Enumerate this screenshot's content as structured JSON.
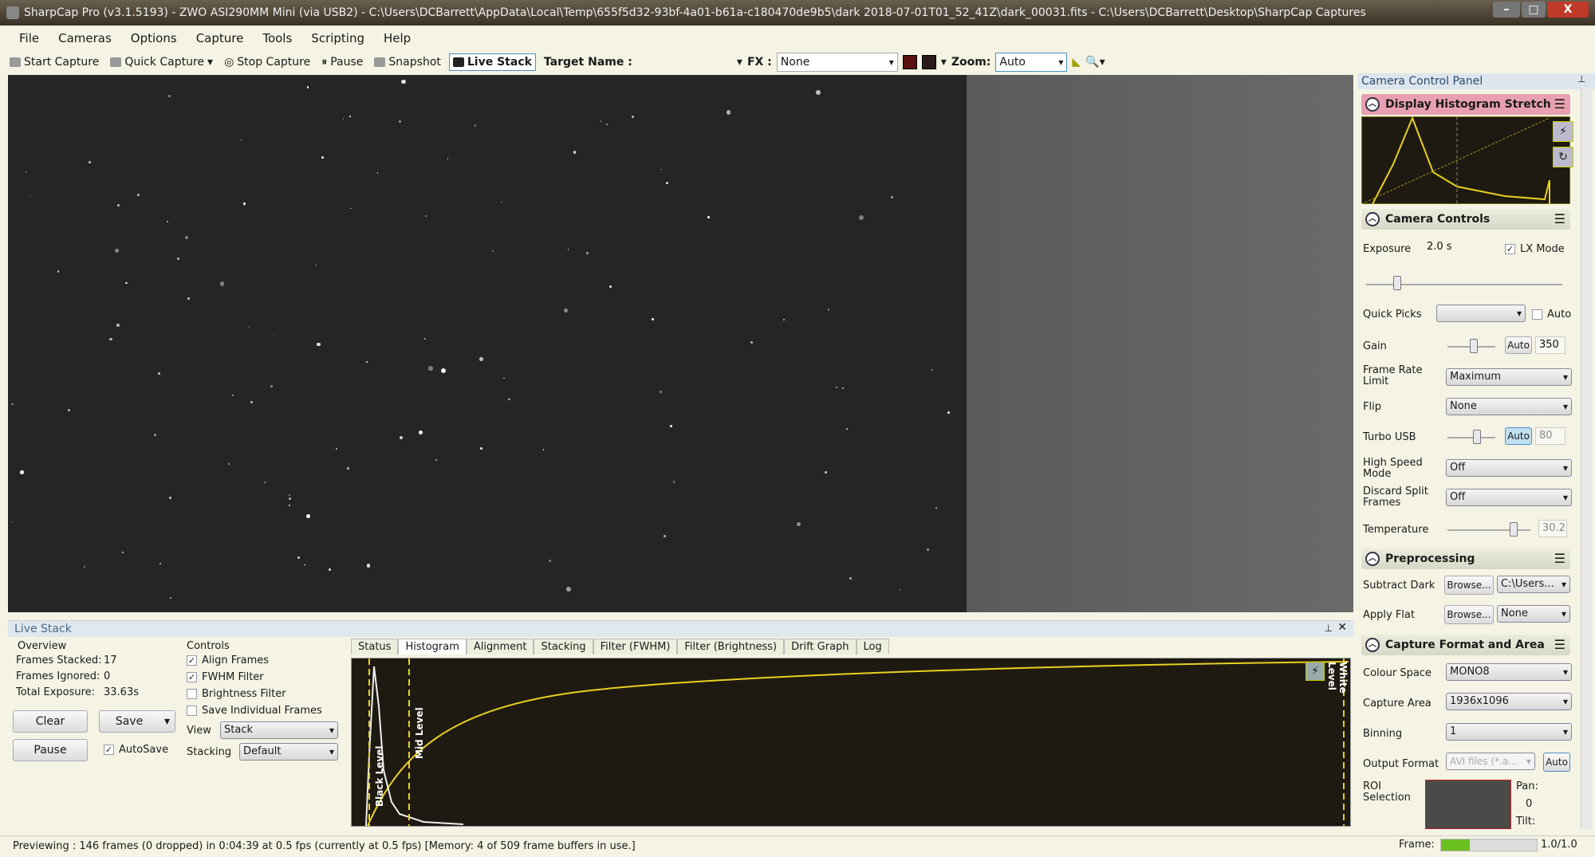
{
  "window": {
    "title": "SharpCap Pro (v3.1.5193) - ZWO ASI290MM Mini (via USB2) - C:\\Users\\DCBarrett\\AppData\\Local\\Temp\\655f5d32-93bf-4a01-b61a-c180470de9b5\\dark 2018-07-01T01_52_41Z\\dark_00031.fits - C:\\Users\\DCBarrett\\Desktop\\SharpCap Captures",
    "min": "–",
    "max": "□",
    "close": "X"
  },
  "menu": [
    "File",
    "Cameras",
    "Options",
    "Capture",
    "Tools",
    "Scripting",
    "Help"
  ],
  "toolbar": {
    "start_capture": "Start Capture",
    "quick_capture": "Quick Capture",
    "stop_capture": "Stop Capture",
    "pause": "Pause",
    "snapshot": "Snapshot",
    "live_stack": "Live Stack",
    "target_name": "Target Name :",
    "fx_label": "FX :",
    "fx_value": "None",
    "zoom_label": "Zoom:",
    "zoom_value": "Auto"
  },
  "live_stack": {
    "title": "Live Stack",
    "overview": "Overview",
    "frames_stacked_label": "Frames Stacked:",
    "frames_stacked": "17",
    "frames_ignored_label": "Frames Ignored:",
    "frames_ignored": "0",
    "total_exposure_label": "Total Exposure:",
    "total_exposure": "33.63s",
    "clear": "Clear",
    "save": "Save",
    "pause": "Pause",
    "autosave": "AutoSave",
    "autosave_checked": true,
    "controls": "Controls",
    "checkboxes": [
      {
        "label": "Align Frames",
        "checked": true
      },
      {
        "label": "FWHM Filter",
        "checked": true
      },
      {
        "label": "Brightness Filter",
        "checked": false
      },
      {
        "label": "Save Individual Frames",
        "checked": false
      }
    ],
    "view_label": "View",
    "view_value": "Stack",
    "stacking_label": "Stacking",
    "stacking_value": "Default",
    "tabs": [
      "Status",
      "Histogram",
      "Alignment",
      "Stacking",
      "Filter (FWHM)",
      "Filter (Brightness)",
      "Drift Graph",
      "Log"
    ],
    "active_tab": "Histogram",
    "hist_labels": {
      "black": "Black Level",
      "mid": "Mid Level",
      "white": "White Level"
    }
  },
  "panel": {
    "title": "Camera Control Panel",
    "display_stretch": "Display Histogram Stretch",
    "camera_controls": "Camera Controls",
    "exposure_label": "Exposure",
    "exposure_value": "2.0 s",
    "lx_mode": "LX Mode",
    "lx_checked": true,
    "quick_picks": "Quick Picks",
    "quick_auto": "Auto",
    "gain_label": "Gain",
    "gain_auto": "Auto",
    "gain_value": "350",
    "gain_level": 0.55,
    "frame_rate_label": "Frame Rate Limit",
    "frame_rate_value": "Maximum",
    "flip_label": "Flip",
    "flip_value": "None",
    "turbo_label": "Turbo USB",
    "turbo_auto": "Auto",
    "turbo_value": "80",
    "hsm_label": "High Speed Mode",
    "hsm_value": "Off",
    "discard_label": "Discard Split Frames",
    "discard_value": "Off",
    "temp_label": "Temperature",
    "temp_value": "30.2",
    "preprocessing": "Preprocessing",
    "subtract_dark_label": "Subtract Dark",
    "browse": "Browse...",
    "subtract_dark_value": "C:\\Users...",
    "apply_flat_label": "Apply Flat",
    "apply_flat_value": "None",
    "capture_format": "Capture Format and Area",
    "colour_space_label": "Colour Space",
    "colour_space_value": "MONO8",
    "capture_area_label": "Capture Area",
    "capture_area_value": "1936x1096",
    "binning_label": "Binning",
    "binning_value": "1",
    "output_format_label": "Output Format",
    "output_format_value": "AVI files (*.a...",
    "output_auto": "Auto",
    "roi_label": "ROI Selection",
    "pan_label": "Pan:",
    "pan_value": "0",
    "tilt_label": "Tilt:",
    "frame_label": "Frame:",
    "frame_value": "1.0/1.0",
    "frame_progress": 0.3
  },
  "status": "Previewing : 146 frames (0 dropped) in 0:04:39 at 0.5 fps  (currently at 0.5 fps) [Memory: 4 of 509 frame buffers in use.]",
  "colors": {
    "histogram_line": "#e8d020",
    "stretch_header": "#e8a0b0",
    "accent": "#4a90c0"
  }
}
